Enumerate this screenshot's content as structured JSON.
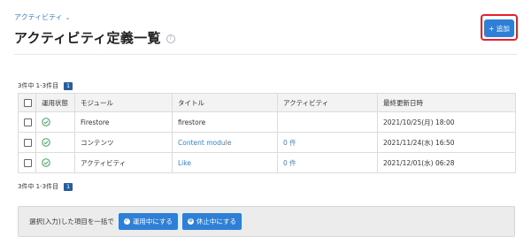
{
  "breadcrumb": {
    "label": "アクティビティ",
    "chevron": "chevron-down-icon"
  },
  "page": {
    "title": "アクティビティ定義一覧",
    "help_icon": "help-icon"
  },
  "toolbar": {
    "add_label": "+ 追加",
    "highlight_color": "#e8202a",
    "accent": "#2f7fd6"
  },
  "pagination_top": {
    "count": "3件中 1-3件目",
    "page": "1"
  },
  "pagination_bottom": {
    "count": "3件中 1-3件目",
    "page": "1"
  },
  "table": {
    "columns": [
      "",
      "運用状態",
      "モジュール",
      "タイトル",
      "アクティビティ",
      "最終更新日時"
    ],
    "rows": [
      {
        "module": "Firestore",
        "title": "firestore",
        "title_link": false,
        "activity": "",
        "updated": "2021/10/25(月) 18:00"
      },
      {
        "module": "コンテンツ",
        "title": "Content module",
        "title_link": true,
        "activity": "0 件",
        "updated": "2021/11/24(水) 16:50"
      },
      {
        "module": "アクティビティ",
        "title": "Like",
        "title_link": true,
        "activity": "0 件",
        "updated": "2021/12/01(水) 06:28"
      }
    ]
  },
  "bulk": {
    "label": "選択(入力)した項目を一括で",
    "activate_label": "運用中にする",
    "deactivate_label": "休止中にする"
  }
}
